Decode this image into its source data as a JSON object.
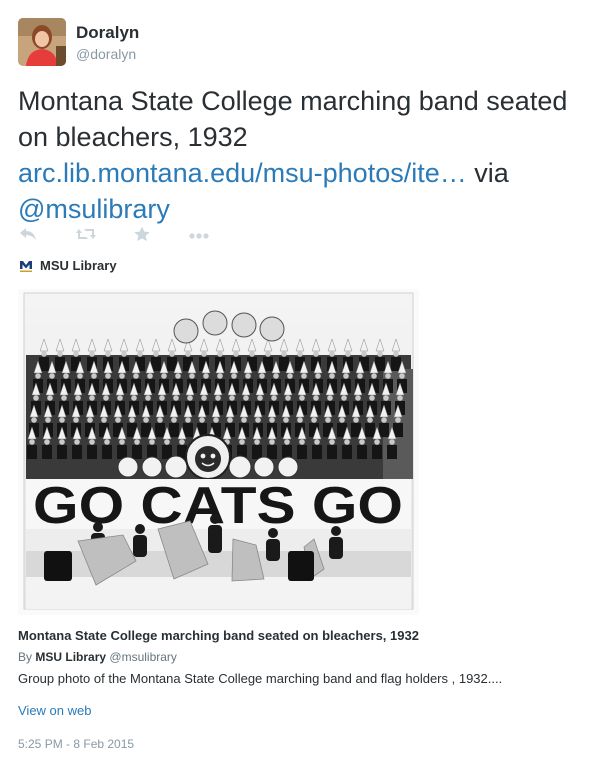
{
  "author": {
    "name": "Doralyn",
    "handle": "@doralyn"
  },
  "tweet": {
    "text_plain": "Montana State College marching band seated on bleachers, 1932",
    "link_text": "arc.lib.montana.edu/msu-photos/ite…",
    "via_word": "via",
    "mention": "@msulibrary"
  },
  "actions": {
    "reply_icon": "reply-icon",
    "retweet_icon": "retweet-icon",
    "favorite_icon": "star-icon",
    "more_icon": "more-icon"
  },
  "card": {
    "source_name": "MSU Library",
    "photo_sign_text": "GO CATS GO",
    "title": "Montana State College marching band seated on bleachers, 1932",
    "by_prefix": "By",
    "by_name": "MSU Library",
    "by_handle": "@msulibrary",
    "description": "Group photo of the Montana State College marching band and flag holders , 1932....",
    "view_on_web": "View on web"
  },
  "timestamp": "5:25 PM - 8 Feb 2015",
  "colors": {
    "link": "#2b7bb9",
    "muted": "#8899a6",
    "text": "#292f33",
    "action_icons": "#ccd6dd"
  }
}
